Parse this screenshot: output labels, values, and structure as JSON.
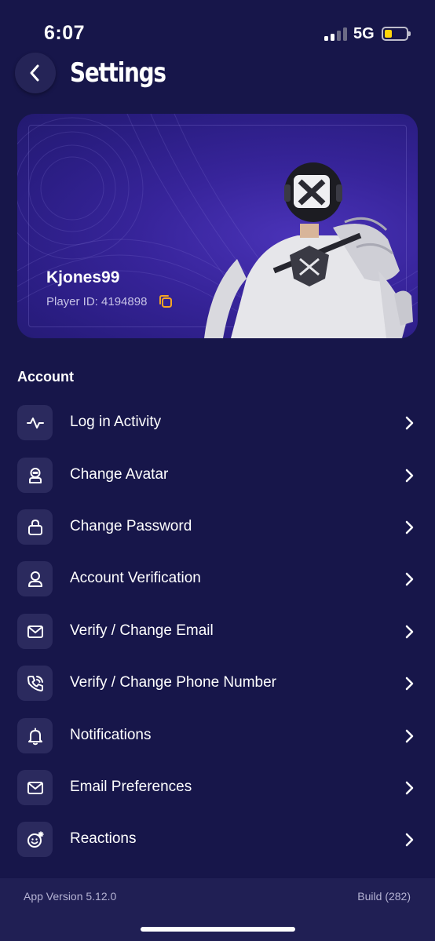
{
  "status_bar": {
    "time": "6:07",
    "network": "5G",
    "battery_level": 0.25,
    "battery_color": "#ffd60a"
  },
  "header": {
    "title": "Settings",
    "back_icon": "chevron-left-icon"
  },
  "profile": {
    "username": "Kjones99",
    "player_id": "Player ID: 4194898",
    "copy_icon": "copy-icon",
    "accent": "#f5a623"
  },
  "account": {
    "section_title": "Account",
    "items": [
      {
        "label": "Log in Activity",
        "icon": "activity-icon"
      },
      {
        "label": "Change Avatar",
        "icon": "avatar-icon"
      },
      {
        "label": "Change Password",
        "icon": "lock-icon"
      },
      {
        "label": "Account Verification",
        "icon": "user-verify-icon"
      },
      {
        "label": "Verify / Change Email",
        "icon": "mail-icon"
      },
      {
        "label": "Verify / Change Phone Number",
        "icon": "phone-icon"
      },
      {
        "label": "Notifications",
        "icon": "bell-icon"
      },
      {
        "label": "Email Preferences",
        "icon": "mail-icon"
      },
      {
        "label": "Reactions",
        "icon": "emoji-icon"
      }
    ]
  },
  "footer": {
    "app_version": "App Version 5.12.0",
    "build": "Build (282)"
  },
  "colors": {
    "background": "#17164a",
    "icon_tile": "#2b2a5e",
    "footer": "#201f54"
  }
}
